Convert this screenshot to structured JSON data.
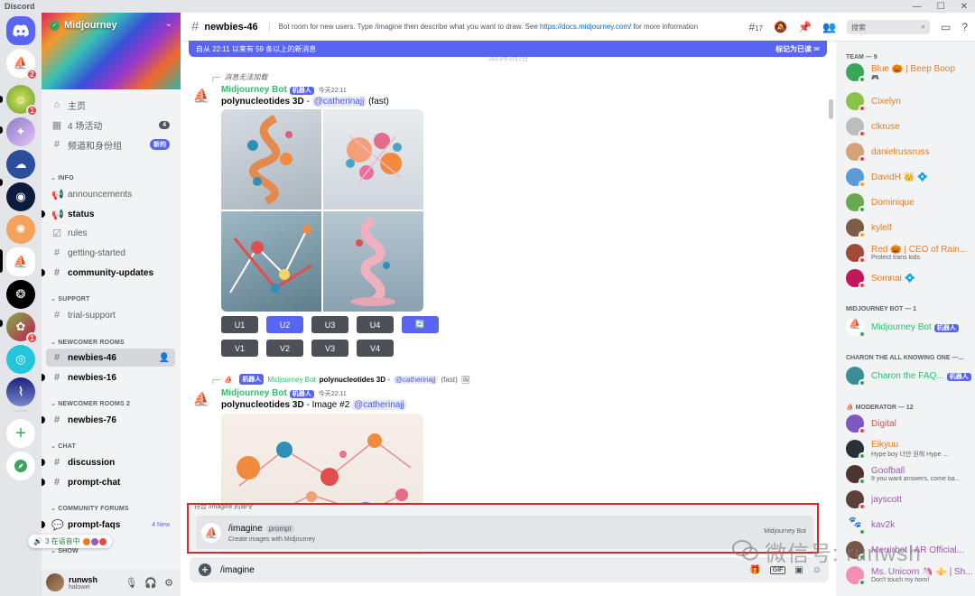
{
  "window": {
    "title": "Discord",
    "controls": [
      "—",
      "☐",
      "✕"
    ]
  },
  "guilds": {
    "badges": {
      "g1": "2",
      "g2": "1",
      "g9": "1"
    },
    "colors": {
      "discord": "#5865f2",
      "add": "#3ba55c",
      "explore": "#3ba55c"
    }
  },
  "server": {
    "name": "Midjourney",
    "top_items": [
      {
        "label": "主页",
        "icon": "home-icon"
      },
      {
        "label": "4 场活动",
        "icon": "calendar-icon",
        "count": "4"
      },
      {
        "label": "频道和身份组",
        "icon": "channels-roles-icon",
        "badge": "新的"
      }
    ],
    "categories": [
      {
        "name": "INFO",
        "channels": [
          {
            "label": "announcements",
            "icon": "megaphone-icon",
            "bold": false
          },
          {
            "label": "status",
            "icon": "megaphone-icon",
            "bold": true
          },
          {
            "label": "rules",
            "icon": "checkbox-icon",
            "bold": false
          },
          {
            "label": "getting-started",
            "icon": "hash-icon",
            "bold": false
          },
          {
            "label": "community-updates",
            "icon": "hash-icon",
            "bold": true
          }
        ]
      },
      {
        "name": "SUPPORT",
        "channels": [
          {
            "label": "trial-support",
            "icon": "hash-icon",
            "bold": false
          }
        ]
      },
      {
        "name": "NEWCOMER ROOMS",
        "channels": [
          {
            "label": "newbies-46",
            "icon": "hash-icon",
            "bold": true,
            "selected": true
          },
          {
            "label": "newbies-16",
            "icon": "hash-icon",
            "bold": true
          }
        ]
      },
      {
        "name": "NEWCOMER ROOMS 2",
        "channels": [
          {
            "label": "newbies-76",
            "icon": "hash-icon",
            "bold": true
          }
        ]
      },
      {
        "name": "CHAT",
        "channels": [
          {
            "label": "discussion",
            "icon": "hash-icon",
            "bold": true
          },
          {
            "label": "prompt-chat",
            "icon": "hash-icon",
            "bold": true
          }
        ]
      },
      {
        "name": "COMMUNITY FORUMS",
        "channels": [
          {
            "label": "prompt-faqs",
            "icon": "forum-icon",
            "bold": true,
            "tag": "4 New"
          }
        ]
      },
      {
        "name": "SHOW",
        "channels": []
      }
    ],
    "voice_popup": "3 在语音中",
    "user": {
      "name": "runwsh",
      "status": "halowei"
    }
  },
  "header": {
    "channel": "newbies-46",
    "topic_prefix": "Bot room for new users. Type /imagine then describe what you want to draw. See ",
    "topic_link": "https://docs.midjourney.com/",
    "topic_suffix": " for more information",
    "thread_count": "17",
    "search_placeholder": "搜索"
  },
  "new_messages_bar": {
    "text": "自从 22:11 以来有 59 条以上的新消息",
    "action": "标记为已读"
  },
  "date_divider": "2023年3月2日",
  "messages": [
    {
      "reply_preview": "消息无法加载",
      "author": "Midjourney Bot",
      "bot_tag": "机器人",
      "time": "今天22:11",
      "prompt": "polynucleotides 3D",
      "sep": " - ",
      "mention": "@catherinajj",
      "suffix": " (fast)",
      "buttons_row1": [
        "U1",
        "U2",
        "U3",
        "U4"
      ],
      "buttons_row2": [
        "V1",
        "V2",
        "V3",
        "V4"
      ],
      "active_button": "U2"
    },
    {
      "reply_bot_tag": "机器人",
      "reply_author": "Midjourney Bot",
      "reply_prompt": "polynucleotides 3D",
      "reply_sep": " - ",
      "reply_mention": "@catherinajj",
      "reply_suffix": " (fast)",
      "author": "Midjourney Bot",
      "bot_tag": "机器人",
      "time": "今天22:11",
      "prompt": "polynucleotides 3D",
      "sep": " - Image #2 ",
      "mention": "@catherinajj"
    }
  ],
  "command_popup": {
    "heading": "符合 /imagine 的命令",
    "name": "/imagine",
    "param": "prompt",
    "description": "Create images with Midjourney",
    "source": "Midjourney Bot"
  },
  "composer": {
    "value": "/imagine",
    "gif_label": "GIF"
  },
  "members": {
    "groups": [
      {
        "title": "TEAM — 9",
        "items": [
          {
            "name": "Blue 🎃 | Beep Boop",
            "sub": "🎮",
            "color": "#e67e22",
            "status": "online"
          },
          {
            "name": "Cixelyn",
            "sub": "",
            "color": "#e67e22",
            "status": "dnd"
          },
          {
            "name": "clkruse",
            "sub": "",
            "color": "#e67e22",
            "status": "dnd"
          },
          {
            "name": "danielrussruss",
            "sub": "",
            "color": "#e67e22",
            "status": "dnd"
          },
          {
            "name": "DavidH 👑 💠",
            "sub": "",
            "color": "#e67e22",
            "status": "idle"
          },
          {
            "name": "Dominique",
            "sub": "",
            "color": "#e67e22",
            "status": "online"
          },
          {
            "name": "kylelf",
            "sub": "",
            "color": "#e67e22",
            "status": "idle"
          },
          {
            "name": "Red 🎃 | CEO of Rain...",
            "sub": "Protect trans kids",
            "color": "#e67e22",
            "status": "dnd"
          },
          {
            "name": "Somnai 💠",
            "sub": "",
            "color": "#e67e22",
            "status": "dnd"
          }
        ]
      },
      {
        "title": "MIDJOURNEY BOT — 1",
        "items": [
          {
            "name": "Midjourney Bot",
            "tag": "机器人",
            "color": "#2fbf71",
            "status": "online"
          }
        ]
      },
      {
        "title": "CHARON THE ALL KNOWING ONE —...",
        "items": [
          {
            "name": "Charon the FAQ...",
            "tag": "机器人",
            "color": "#2fbf71",
            "status": "online"
          }
        ]
      },
      {
        "title": "MODERATOR — 12",
        "items": [
          {
            "name": "Digital",
            "sub": "",
            "color": "#e74c3c",
            "status": "dnd"
          },
          {
            "name": "Eikyuu",
            "sub": "Hype boy 너만 원해 Hype ...",
            "color": "#e67e22",
            "status": "mobile"
          },
          {
            "name": "Goofball",
            "sub": "If you want answers, come ba...",
            "color": "#9b59b6",
            "status": "online"
          },
          {
            "name": "jayscott",
            "sub": "",
            "color": "#9b59b6",
            "status": "dnd"
          },
          {
            "name": "kav2k",
            "sub": "",
            "color": "#9b59b6",
            "status": "online"
          },
          {
            "name": "Merrirbot | AR Official...",
            "sub": "",
            "color": "#9b59b6",
            "status": "online"
          },
          {
            "name": "Ms. Unicorn 🦄 ⚜️ | Sh...",
            "sub": "Don't touch my horn!",
            "color": "#9b59b6",
            "status": "online"
          }
        ]
      }
    ]
  },
  "watermark": "微信号: runwsh"
}
